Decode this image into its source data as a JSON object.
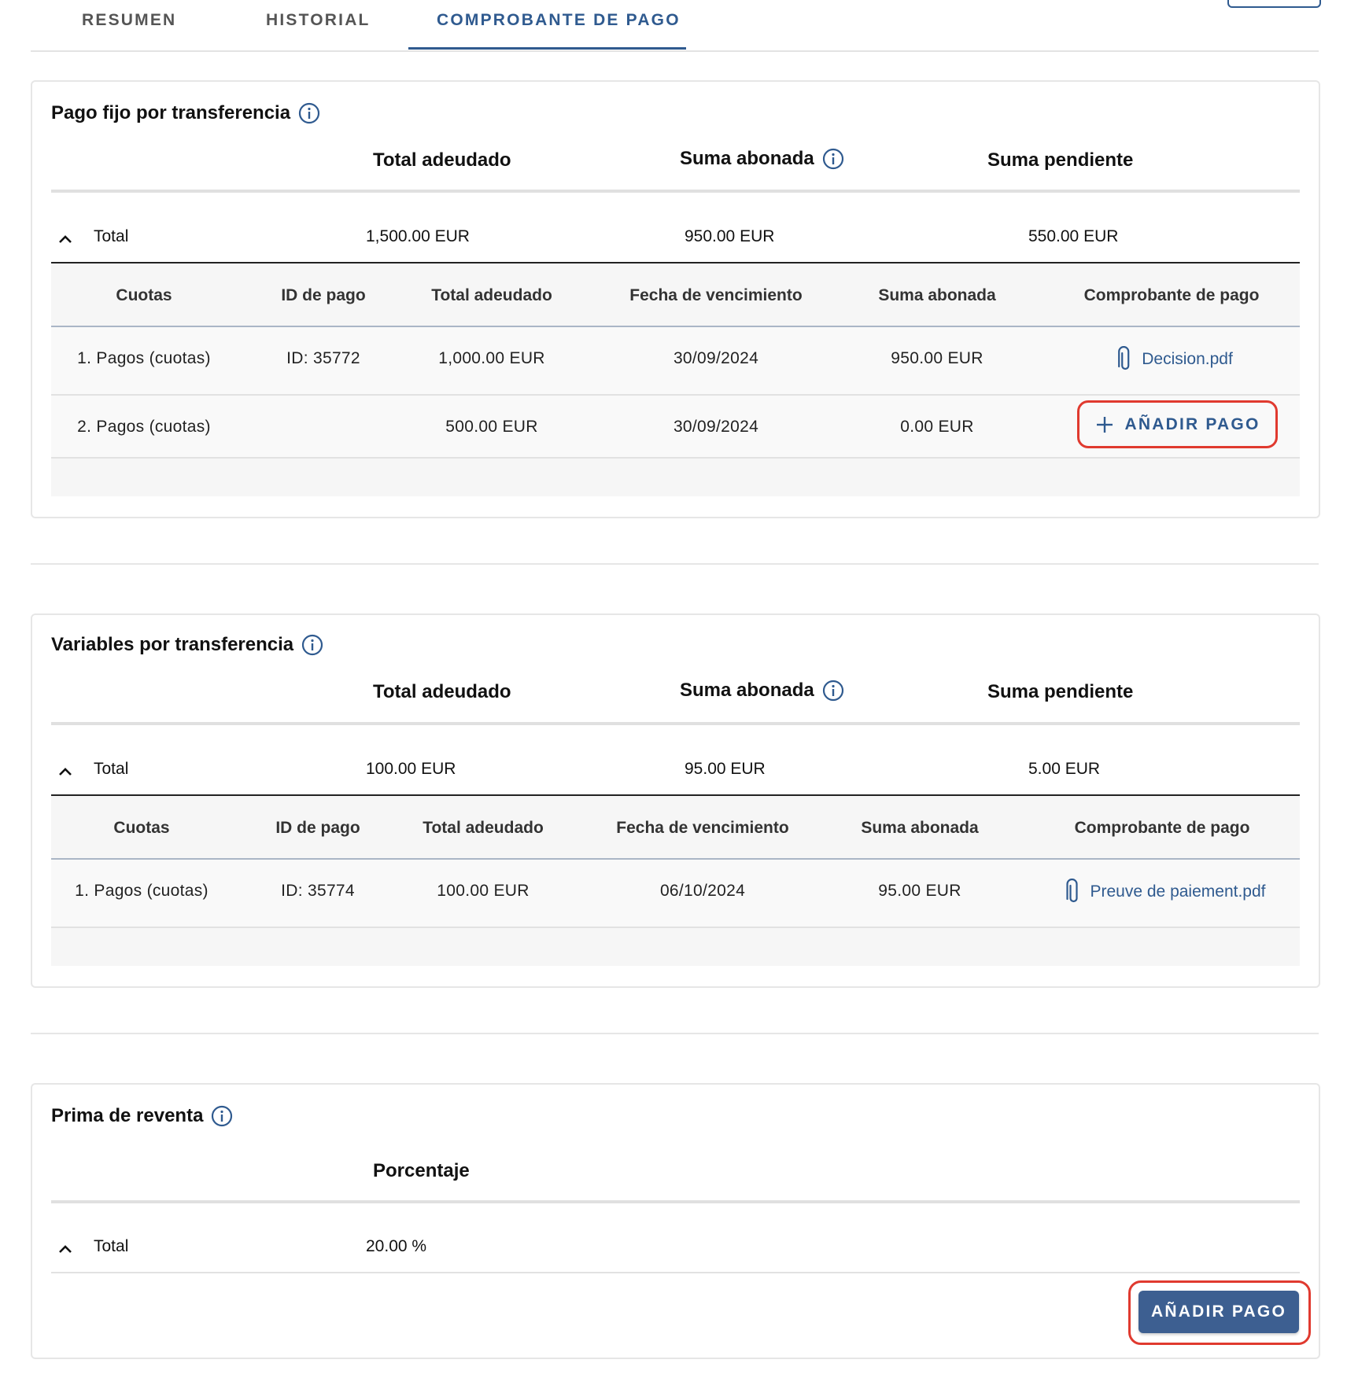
{
  "tabs": [
    {
      "label": "RESUMEN"
    },
    {
      "label": "HISTORIAL"
    },
    {
      "label": "COMPROBANTE DE PAGO"
    }
  ],
  "columns": {
    "total_adeudado": "Total adeudado",
    "suma_abonada": "Suma abonada",
    "suma_pendiente": "Suma pendiente",
    "porcentaje": "Porcentaje",
    "total": "Total"
  },
  "table_headers": [
    "Cuotas",
    "ID de pago",
    "Total adeudado",
    "Fecha de vencimiento",
    "Suma abonada",
    "Comprobante de pago"
  ],
  "section1": {
    "title": "Pago fijo por transferencia",
    "totals": {
      "adeudado": "1,500.00 EUR",
      "abonada": "950.00 EUR",
      "pendiente": "550.00 EUR"
    },
    "rows": [
      {
        "cuotas": "1. Pagos (cuotas)",
        "id": "ID: 35772",
        "adeudado": "1,000.00 EUR",
        "fecha": "30/09/2024",
        "abonada": "950.00 EUR",
        "file": "Decision.pdf"
      },
      {
        "cuotas": "2. Pagos (cuotas)",
        "id": "",
        "adeudado": "500.00 EUR",
        "fecha": "30/09/2024",
        "abonada": "0.00 EUR",
        "action": "AÑADIR PAGO"
      }
    ]
  },
  "section2": {
    "title": "Variables por transferencia",
    "totals": {
      "adeudado": "100.00 EUR",
      "abonada": "95.00 EUR",
      "pendiente": "5.00 EUR"
    },
    "rows": [
      {
        "cuotas": "1. Pagos (cuotas)",
        "id": "ID: 35774",
        "adeudado": "100.00 EUR",
        "fecha": "06/10/2024",
        "abonada": "95.00 EUR",
        "file": "Preuve de paiement.pdf"
      }
    ]
  },
  "section3": {
    "title": "Prima de reventa",
    "total_percent": "20.00 %",
    "button": "AÑADIR PAGO"
  },
  "colors": {
    "accent": "#2f5a8f",
    "highlight": "#e03a2f",
    "button": "#3d5f91"
  }
}
